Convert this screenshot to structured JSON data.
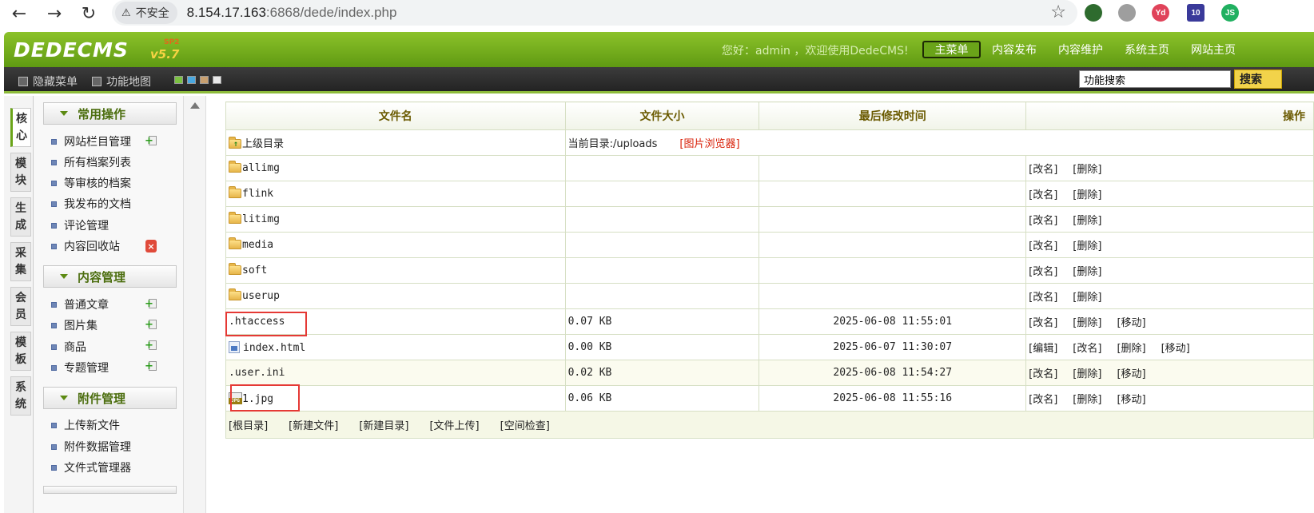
{
  "browser": {
    "security_label": "不安全",
    "url_host": "8.154.17.163",
    "url_port_path": ":6868/dede/index.php",
    "extensions": [
      "Yd",
      "10",
      "JS"
    ]
  },
  "header": {
    "logo": "DEDECMS",
    "version": "v5.7",
    "edition": "SP2",
    "welcome": "您好：admin ，欢迎使用DedeCMS!",
    "nav": [
      "主菜单",
      "内容发布",
      "内容维护",
      "系统主页",
      "网站主页"
    ]
  },
  "toolbar": {
    "hide_menu": "隐藏菜单",
    "func_map": "功能地图",
    "search_value": "功能搜索",
    "search_btn": "搜索"
  },
  "left_tabs": [
    [
      "核",
      "心"
    ],
    [
      "模",
      "块"
    ],
    [
      "生",
      "成"
    ],
    [
      "采",
      "集"
    ],
    [
      "会",
      "员"
    ],
    [
      "模",
      "板"
    ],
    [
      "系",
      "统"
    ]
  ],
  "menu": {
    "sections": [
      {
        "title": "常用操作",
        "items": [
          "网站栏目管理",
          "所有档案列表",
          "等审核的档案",
          "我发布的文档",
          "评论管理",
          "内容回收站"
        ]
      },
      {
        "title": "内容管理",
        "items": [
          "普通文章",
          "图片集",
          "商品",
          "专题管理"
        ]
      },
      {
        "title": "附件管理",
        "items": [
          "上传新文件",
          "附件数据管理",
          "文件式管理器"
        ]
      }
    ]
  },
  "table": {
    "headers": {
      "name": "文件名",
      "size": "文件大小",
      "time": "最后修改时间",
      "ops": "操作"
    },
    "parent": {
      "name": "上级目录",
      "current": "当前目录:/uploads",
      "browser_link": "[图片浏览器]"
    },
    "folders": [
      {
        "name": "allimg",
        "ops": [
          "[改名]",
          "[删除]"
        ]
      },
      {
        "name": "flink",
        "ops": [
          "[改名]",
          "[删除]"
        ]
      },
      {
        "name": "litimg",
        "ops": [
          "[改名]",
          "[删除]"
        ]
      },
      {
        "name": "media",
        "ops": [
          "[改名]",
          "[删除]"
        ]
      },
      {
        "name": "soft",
        "ops": [
          "[改名]",
          "[删除]"
        ]
      },
      {
        "name": "userup",
        "ops": [
          "[改名]",
          "[删除]"
        ]
      }
    ],
    "files": [
      {
        "name": ".htaccess",
        "size": "0.07 KB",
        "time": "2025-06-08 11:55:01",
        "ops": [
          "[改名]",
          "[删除]",
          "[移动]"
        ]
      },
      {
        "name": "index.html",
        "size": "0.00 KB",
        "time": "2025-06-07 11:30:07",
        "ops": [
          "[编辑]",
          "[改名]",
          "[删除]",
          "[移动]"
        ]
      },
      {
        "name": ".user.ini",
        "size": "0.02 KB",
        "time": "2025-06-08 11:54:27",
        "ops": [
          "[改名]",
          "[删除]",
          "[移动]"
        ]
      },
      {
        "name": "1.jpg",
        "size": "0.06 KB",
        "time": "2025-06-08 11:55:16",
        "ops": [
          "[改名]",
          "[删除]",
          "[移动]"
        ]
      }
    ],
    "footer": [
      "[根目录]",
      "[新建文件]",
      "[新建目录]",
      "[文件上传]",
      "[空间检查]"
    ]
  },
  "colors": {
    "brand_green": "#6aa419",
    "highlight_red": "#e53935",
    "link_red": "#d81e06"
  }
}
